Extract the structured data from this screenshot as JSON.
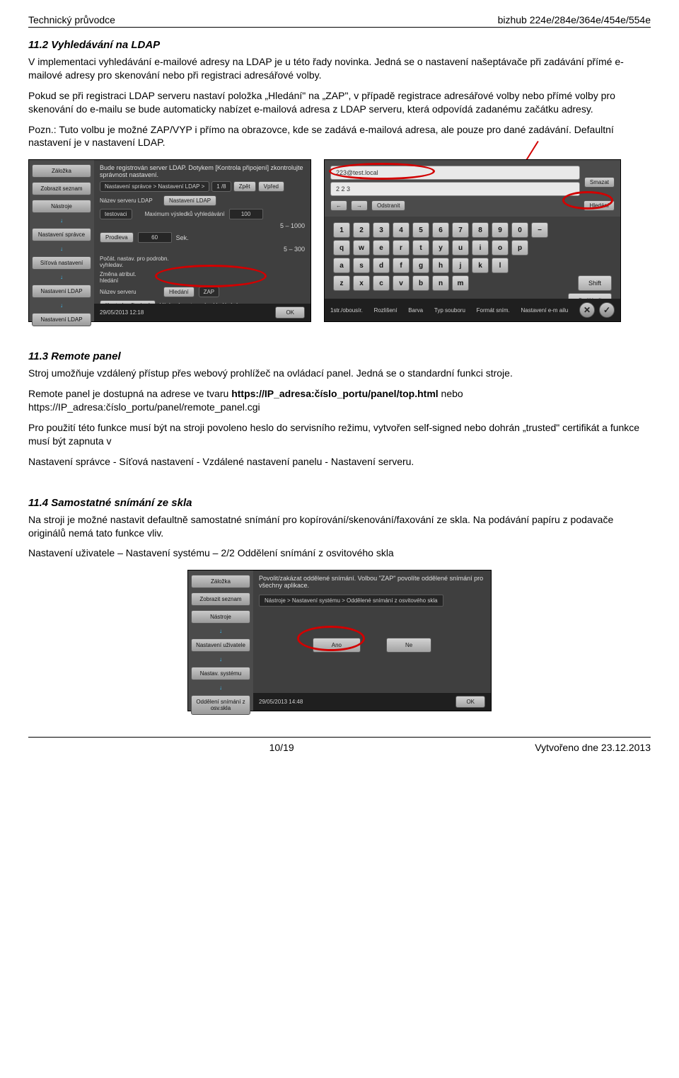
{
  "header": {
    "left": "Technický průvodce",
    "right": "bizhub 224e/284e/364e/454e/554e"
  },
  "sec_11_2": {
    "heading": "11.2   Vyhledávání na LDAP",
    "p1": "V implementaci vyhledávání e-mailové adresy na LDAP je u této řady novinka. Jedná se o nastavení našeptávače při zadávání přímé e-mailové adresy pro skenování nebo při registraci adresářové volby.",
    "p2": "Pokud se při registraci LDAP serveru nastaví položka „Hledání\" na „ZAP\", v případě registrace adresářové volby nebo přímé volby pro skenování do e-mailu se bude automaticky nabízet e-mailová adresa z LDAP serveru, která odpovídá zadanému začátku adresy.",
    "p3": "Pozn.: Tuto volbu je možné ZAP/VYP i přímo na obrazovce, kde se zadává e-mailová adresa, ale pouze pro dané zadávání. Defaultní nastavení je v nastavení LDAP."
  },
  "panel_left": {
    "title": "Bude registrován server LDAP.\nDotykem [Kontrola připojení] zkontrolujte správnost nastavení.",
    "sidebar": [
      "Záložka",
      "Zobrazit seznam",
      "Nástroje",
      "Nastavení správce",
      "Síťová nastavení",
      "Nastavení LDAP",
      "Nastavení LDAP"
    ],
    "breadcrumb": "Nastavení správce > Nastavení LDAP >",
    "page": "1 /8",
    "back_btn": "Zpět",
    "fwd_btn": "Vpřed",
    "rows": {
      "nazev_label": "Název serveru LDAP",
      "nazev_btn": "Nastavení LDAP",
      "max_label": "Maximum výsledků vyhledávání",
      "max_val": "100",
      "max_range": "5 – 1000",
      "prodleva_label": "",
      "prodleva_btn": "Prodleva",
      "prodleva_val": "60",
      "prodleva_unit": "Sek.",
      "prodleva_range": "5 – 300",
      "testovaci": "testovaci",
      "pocat_label": "Počát. nastav. pro podrobn. vyhledav.",
      "zmena_label": "Změna atribut. hledání",
      "hledani": "Hledání",
      "zap": "ZAP",
      "nazev_serveru_label": "Název serveru",
      "kontrola": "Kontrola připojení",
      "vychozi": "Výchozí nastavení vyhledávání"
    },
    "footer_time": "29/05/2013    12:18",
    "footer_ok": "OK"
  },
  "panel_right": {
    "input1": "223@test.local",
    "input2": "2 2 3",
    "smazat": "Smazat",
    "arrow_left": "←",
    "arrow_right": "→",
    "odstranit": "Odstranit",
    "hledani": "Hledání",
    "kb_rows": [
      [
        "1",
        "2",
        "3",
        "4",
        "5",
        "6",
        "7",
        "8",
        "9",
        "0",
        "−"
      ],
      [
        "q",
        "w",
        "e",
        "r",
        "t",
        "y",
        "u",
        "i",
        "o",
        "p"
      ],
      [
        "a",
        "s",
        "d",
        "f",
        "g",
        "h",
        "j",
        "k",
        "l"
      ],
      [
        "z",
        "x",
        "c",
        "v",
        "b",
        "n",
        "m"
      ]
    ],
    "shift": "Shift",
    "dalsi": "Další cíl",
    "footer_left": "1str./obousír.",
    "footer_items": [
      "Rozlišení",
      "Barva",
      "Typ souboru",
      "Formát sním.",
      "Nastavení e-m ailu"
    ],
    "circ_x": "✕",
    "circ_check": "✓"
  },
  "sec_11_3": {
    "heading": "11.3   Remote panel",
    "p1": "Stroj umožňuje vzdálený přístup přes webový prohlížeč na ovládací panel. Jedná se o standardní funkci stroje.",
    "p2a": "Remote panel je dostupná na adrese ve tvaru ",
    "p2b": "https://IP_adresa:číslo_portu/panel/top.html",
    "p2c": " nebo https://IP_adresa:číslo_portu/panel/remote_panel.cgi",
    "p3": "Pro použití této funkce musí být na stroji povoleno heslo do servisního režimu, vytvořen self-signed nebo dohrán „trusted\" certifikát a funkce musí být zapnuta v",
    "p4": "Nastavení správce - Síťová nastavení - Vzdálené nastavení panelu - Nastavení serveru."
  },
  "sec_11_4": {
    "heading": "11.4   Samostatné snímání ze skla",
    "p1": "Na stroji je možné nastavit defaultně samostatné snímání pro kopírování/skenování/faxování ze skla. Na podávání papíru z podavače originálů nemá tato funkce vliv.",
    "p2": "Nastavení uživatele – Nastavení systému – 2/2 Oddělení snímání z osvitového skla"
  },
  "panel_bottom": {
    "title": "Povolit/zakázat oddělené snímání.\nVolbou \"ZAP\" povolíte oddělené snímání pro všechny aplikace.",
    "sidebar": [
      "Záložka",
      "Zobrazit seznam",
      "Nástroje",
      "Nastavení uživatele",
      "Nastav. systému",
      "Oddělení snímání z osv.skla"
    ],
    "breadcrumb": "Nástroje > Nastavení systému > Oddělené snímání z osvitového skla",
    "ano": "Ano",
    "ne": "Ne",
    "footer_time": "29/05/2013    14:48",
    "footer_ok": "OK"
  },
  "footer": {
    "page": "10/19",
    "date": "Vytvořeno dne 23.12.2013"
  }
}
